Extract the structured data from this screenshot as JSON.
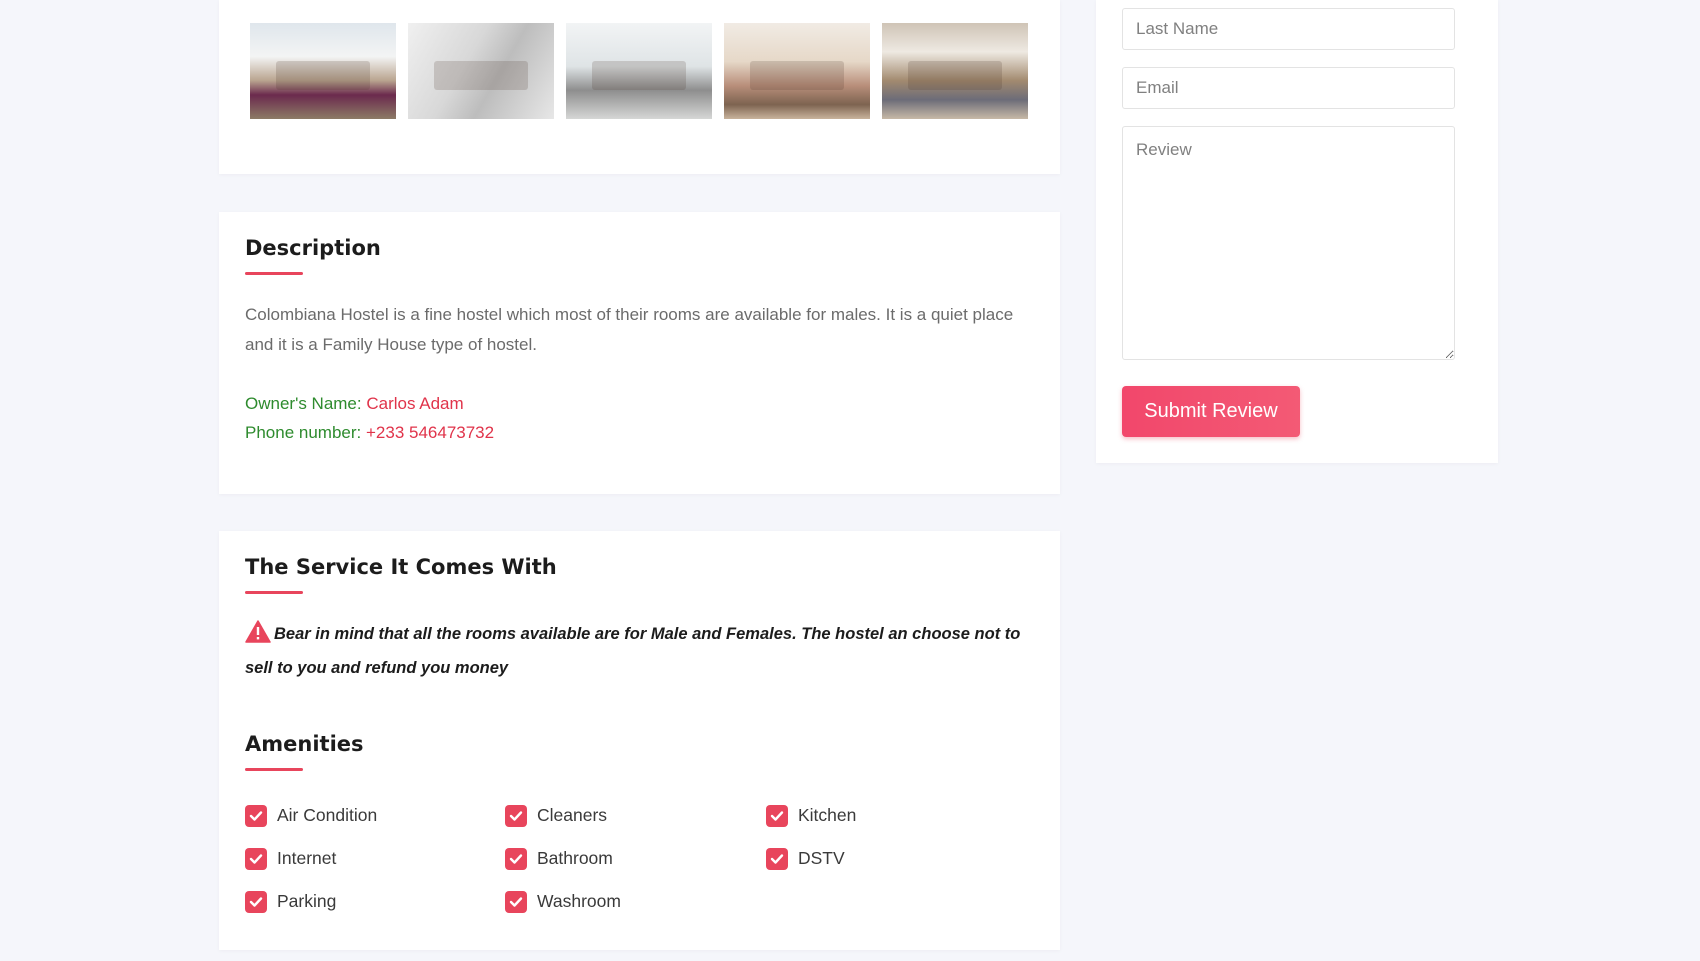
{
  "gallery": {
    "thumbnails": [
      "dining-room-photo",
      "stairs-photo",
      "kitchen-dining-photo",
      "living-room-photo",
      "kitchen-photo"
    ]
  },
  "description": {
    "title": "Description",
    "text": "Colombiana Hostel is a fine hostel which most of their rooms are available for males. It is a quiet place and it is a Family House type of hostel.",
    "owner_label": "Owner's Name:",
    "owner_value": "Carlos Adam",
    "phone_label": "Phone number:",
    "phone_value": "+233 546473732"
  },
  "service": {
    "title": "The Service It Comes With",
    "notice": "Bear in mind that all the rooms available are for Male and Females. The hostel an choose not to sell to you and refund you money",
    "amenities_title": "Amenities",
    "amenities": [
      {
        "label": "Air Condition",
        "checked": true
      },
      {
        "label": "Cleaners",
        "checked": true
      },
      {
        "label": "Kitchen",
        "checked": true
      },
      {
        "label": "Internet",
        "checked": true
      },
      {
        "label": "Bathroom",
        "checked": true
      },
      {
        "label": "DSTV",
        "checked": true
      },
      {
        "label": "Parking",
        "checked": true
      },
      {
        "label": "Washroom",
        "checked": true
      }
    ]
  },
  "review_form": {
    "last_name_placeholder": "Last Name",
    "email_placeholder": "Email",
    "review_placeholder": "Review",
    "submit_label": "Submit Review"
  },
  "colors": {
    "accent": "#e8455c",
    "owner_label": "#2e8b2e",
    "owner_value": "#e0334a",
    "page_background": "#f5f6fb"
  }
}
